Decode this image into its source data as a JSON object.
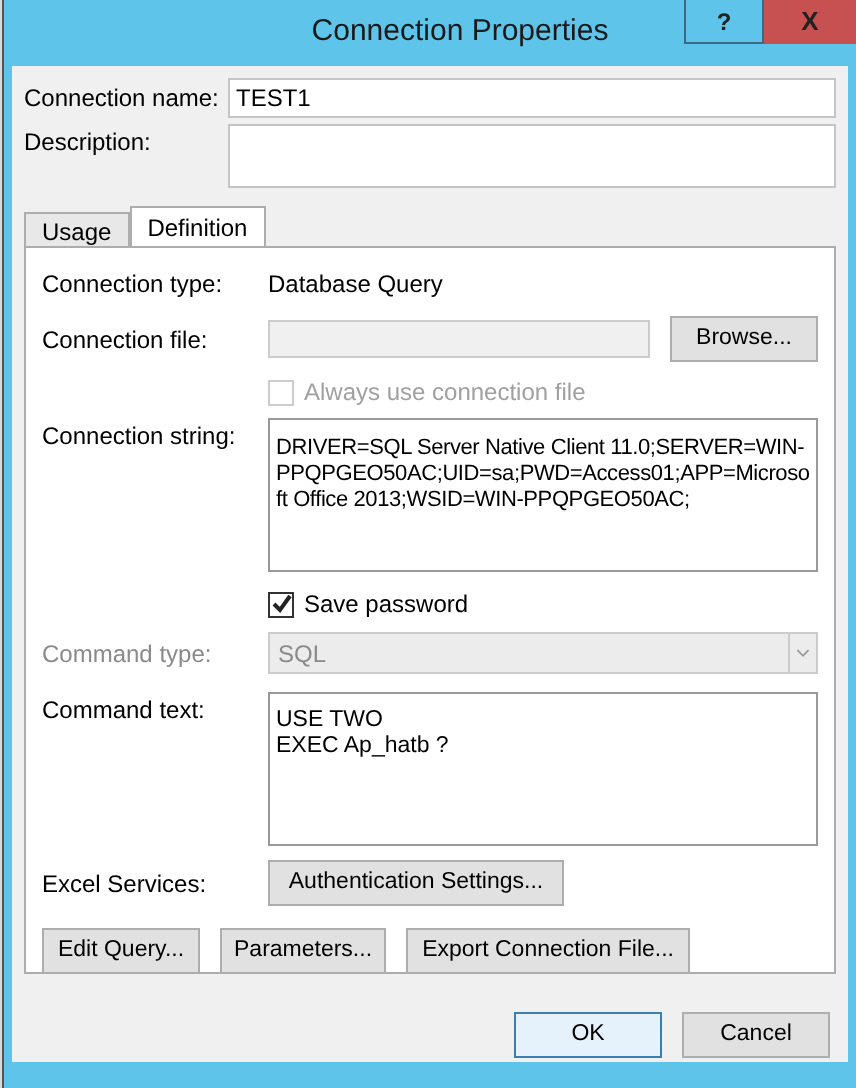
{
  "window": {
    "title": "Connection Properties",
    "help_button": "?",
    "close_button": "X"
  },
  "connection_name": {
    "label": "Connection name:",
    "value": "TEST1"
  },
  "description": {
    "label": "Description:"
  },
  "tabs": [
    {
      "label": "Usage",
      "selected": false
    },
    {
      "label": "Definition",
      "selected": true
    }
  ],
  "definition": {
    "connection_type": {
      "label": "Connection type:",
      "value": "Database Query"
    },
    "connection_file": {
      "label": "Connection file:",
      "disabled": true,
      "button": "Browse..."
    },
    "always_use": {
      "label": "Always use connection file",
      "checked": false,
      "disabled": true
    },
    "connection_string": {
      "label": "Connection string:",
      "value": "DRIVER=SQL Server Native Client 11.0;SERVER=WIN-PPQPGEO50AC;UID=sa;PWD=Access01;APP=Microsoft Office 2013;WSID=WIN-PPQPGEO50AC;"
    },
    "save_password": {
      "label": "Save password",
      "checked": true,
      "disabled": false
    },
    "command_type": {
      "label": "Command type:",
      "value": "SQL",
      "disabled": true
    },
    "command_text": {
      "label": "Command text:",
      "lines": [
        "USE TWO",
        "EXEC Ap_hatb ?"
      ]
    },
    "excel_services": {
      "label": "Excel Services:",
      "button": "Authentication Settings..."
    },
    "buttons": [
      "Edit Query...",
      "Parameters...",
      "Export Connection File..."
    ]
  },
  "footer_buttons": [
    {
      "label": "OK",
      "selected": true
    },
    {
      "label": "Cancel",
      "selected": false
    }
  ]
}
